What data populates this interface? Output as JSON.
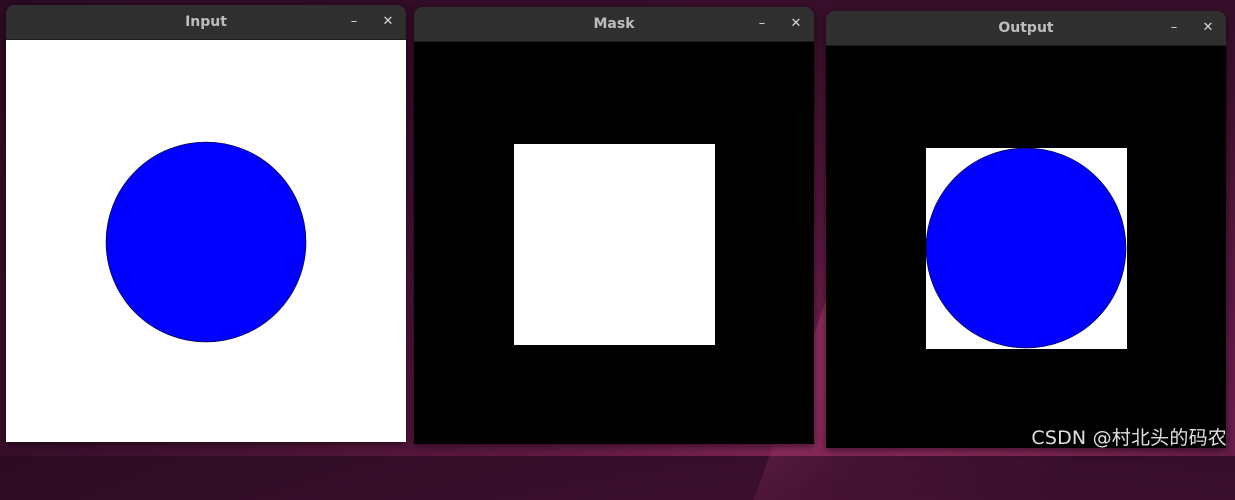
{
  "windows": {
    "input": {
      "title": "Input",
      "minimize_glyph": "–",
      "close_glyph": "✕",
      "image": {
        "background_color": "#ffffff",
        "shape": "circle",
        "fill_color": "#0000ff"
      }
    },
    "mask": {
      "title": "Mask",
      "minimize_glyph": "–",
      "close_glyph": "✕",
      "image": {
        "background_color": "#000000",
        "shape": "square",
        "fill_color": "#ffffff"
      }
    },
    "output": {
      "title": "Output",
      "minimize_glyph": "–",
      "close_glyph": "✕",
      "image": {
        "background_color": "#000000",
        "square_fill_color": "#ffffff",
        "circle_fill_color": "#0000ff"
      }
    }
  },
  "colors": {
    "titlebar": "#2f2f2f",
    "title_text": "#bdbdbd"
  },
  "icons": {
    "minimize": "minimize-icon",
    "close": "close-icon"
  },
  "watermark": {
    "text": "CSDN @村北头的码农"
  }
}
